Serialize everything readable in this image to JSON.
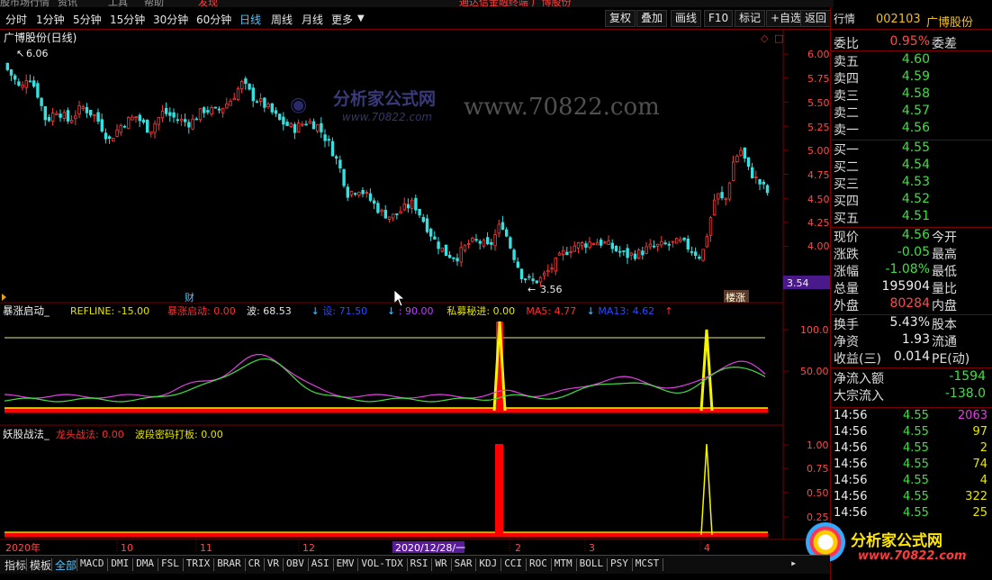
{
  "top_menu": [
    "股市场行情",
    "资讯",
    "工具",
    "帮助",
    "发现"
  ],
  "top_banner": "通达信金融终端 广博股份",
  "periods": [
    {
      "label": "分时",
      "selected": false
    },
    {
      "label": "1分钟",
      "selected": false
    },
    {
      "label": "5分钟",
      "selected": false
    },
    {
      "label": "15分钟",
      "selected": false
    },
    {
      "label": "30分钟",
      "selected": false
    },
    {
      "label": "60分钟",
      "selected": false
    },
    {
      "label": "日线",
      "selected": true
    },
    {
      "label": "周线",
      "selected": false
    },
    {
      "label": "月线",
      "selected": false
    },
    {
      "label": "更多",
      "selected": false
    }
  ],
  "right_tools": [
    "复权",
    "叠加",
    "画线",
    "F10",
    "标记",
    "+自选",
    "返回"
  ],
  "stock": {
    "code": "002103",
    "name": "广博股份"
  },
  "chart_title": "广博股份(日线)",
  "watermark": {
    "text1": "分析家公式网",
    "text2": "www.70822.com",
    "text3": "www.70822.com"
  },
  "price_axis": [
    "6.00",
    "5.75",
    "5.50",
    "5.25",
    "5.00",
    "4.75",
    "4.50",
    "4.25",
    "4.00"
  ],
  "price_tag": "3.54",
  "marks": {
    "high": "6.06",
    "low": "3.56",
    "cai": "财",
    "lou": "楼涨"
  },
  "ind1": {
    "name": "暴涨启动_",
    "legend": [
      {
        "t": "REFLINE: -15.00",
        "c": "#e6e600"
      },
      {
        "t": "暴涨启动: 0.00",
        "c": "#ff3030"
      },
      {
        "t": "波: 68.53",
        "c": "#e6e6e6"
      },
      {
        "t": "↓",
        "c": "#4fc3ff"
      },
      {
        "t": "设: 71.50",
        "c": "#2a4bff"
      },
      {
        "t": "↓",
        "c": "#4fc3ff"
      },
      {
        "t": ": 90.00",
        "c": "#c040ff"
      },
      {
        "t": "私募秘进: 0.00",
        "c": "#e6e600"
      },
      {
        "t": "MA5: 4.77",
        "c": "#ff3030"
      },
      {
        "t": "↓",
        "c": "#4fc3ff"
      },
      {
        "t": "MA13: 4.62",
        "c": "#2a4bff"
      },
      {
        "t": "↑",
        "c": "#ff3030"
      }
    ],
    "axis": [
      "100.0",
      "50.00"
    ]
  },
  "ind2": {
    "name": "妖股战法_",
    "legend": [
      {
        "t": "龙头战法: 0.00",
        "c": "#ff3030"
      },
      {
        "t": "波段密码打板: 0.00",
        "c": "#e6e600"
      }
    ],
    "axis": [
      "1.00",
      "0.75",
      "0.50",
      "0.25"
    ]
  },
  "date_axis": {
    "labels": [
      "2020年",
      "10",
      "11",
      "12",
      "2",
      "3",
      "4"
    ],
    "cursor": "2020/12/28/一"
  },
  "quote": {
    "wei_bi": {
      "label": "委比",
      "value": "0.95%",
      "label2": "委差"
    },
    "sell": [
      {
        "label": "卖五",
        "price": "4.60"
      },
      {
        "label": "卖四",
        "price": "4.59"
      },
      {
        "label": "卖三",
        "price": "4.58"
      },
      {
        "label": "卖二",
        "price": "4.57"
      },
      {
        "label": "卖一",
        "price": "4.56"
      }
    ],
    "buy": [
      {
        "label": "买一",
        "price": "4.55"
      },
      {
        "label": "买二",
        "price": "4.54"
      },
      {
        "label": "买三",
        "price": "4.53"
      },
      {
        "label": "买四",
        "price": "4.52"
      },
      {
        "label": "买五",
        "price": "4.51"
      }
    ],
    "stats": [
      {
        "label": "现价",
        "value": "4.56",
        "color": "dn",
        "label2": "今开"
      },
      {
        "label": "涨跌",
        "value": "-0.05",
        "color": "dn",
        "label2": "最高"
      },
      {
        "label": "涨幅",
        "value": "-1.08%",
        "color": "dn",
        "label2": "最低"
      },
      {
        "label": "总量",
        "value": "195904",
        "color": "wh",
        "label2": "量比"
      },
      {
        "label": "外盘",
        "value": "80284",
        "color": "up",
        "label2": "内盘"
      }
    ],
    "stats2": [
      {
        "label": "换手",
        "value": "5.43%",
        "label2": "股本"
      },
      {
        "label": "净资",
        "value": "1.93",
        "label2": "流通"
      },
      {
        "label": "收益(三)",
        "value": "0.014",
        "label2": "PE(动)"
      }
    ],
    "flow": [
      {
        "label": "净流入额",
        "value": "-1594"
      },
      {
        "label": "大宗流入",
        "value": "-138.0"
      }
    ],
    "ticks": [
      {
        "time": "14:56",
        "price": "4.55",
        "vol": "2063",
        "vc": "#e040e0"
      },
      {
        "time": "14:56",
        "price": "4.55",
        "vol": "97",
        "vc": "#e6e600"
      },
      {
        "time": "14:56",
        "price": "4.55",
        "vol": "2",
        "vc": "#e6e600"
      },
      {
        "time": "14:56",
        "price": "4.55",
        "vol": "74",
        "vc": "#e6e600"
      },
      {
        "time": "14:56",
        "price": "4.55",
        "vol": "4",
        "vc": "#e6e600"
      },
      {
        "time": "14:56",
        "price": "4.55",
        "vol": "322",
        "vc": "#e6e600"
      },
      {
        "time": "14:56",
        "price": "4.55",
        "vol": "25",
        "vc": "#e6e600"
      }
    ]
  },
  "logo": {
    "text1": "分析家公式网",
    "text2": "www.70822.com"
  },
  "bottom_tabs": [
    "指标",
    "模板",
    "全部",
    "MACD",
    "DMI",
    "DMA",
    "FSL",
    "TRIX",
    "BRAR",
    "CR",
    "VR",
    "OBV",
    "ASI",
    "EMV",
    "VOL-TDX",
    "RSI",
    "WR",
    "SAR",
    "KDJ",
    "CCI",
    "ROC",
    "MTM",
    "BOLL",
    "PSY",
    "MCST"
  ],
  "colors": {
    "up": "#ff3b3b",
    "down": "#35e0e0",
    "grid": "#7a0000",
    "yellow": "#f5f500",
    "red": "#ff0000"
  }
}
